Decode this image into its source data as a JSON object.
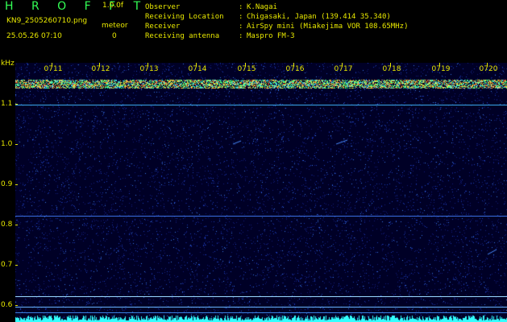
{
  "header": {
    "title": "H R O F F T",
    "version": "1.0.0f",
    "filename": "KN9_2505260710.png",
    "meteor_label": "meteor",
    "meteor_count": "0",
    "datetime": "25.05.26 07:10"
  },
  "info": {
    "rows": [
      {
        "key": "Observer",
        "value": "K.Nagai"
      },
      {
        "key": "Receiving Location",
        "value": "Chigasaki, Japan (139.414 35.340)"
      },
      {
        "key": "Receiver",
        "value": "AirSpy mini (Miakejima VOR 108.65MHz)"
      },
      {
        "key": "Receiving antenna",
        "value": "Maspro FM-3"
      }
    ],
    "colon": ":"
  },
  "axis": {
    "unit": "kHz",
    "y_labels": [
      "1.1",
      "1.0",
      "0.9",
      "0.8",
      "0.7",
      "0.6"
    ],
    "time_labels": [
      "0711",
      "0712",
      "0713",
      "0714",
      "0715",
      "0716",
      "0717",
      "0718",
      "0719",
      "0720"
    ]
  },
  "colors": {
    "label": "#e8e800",
    "background": "#000026",
    "signal": "#33ffff"
  }
}
